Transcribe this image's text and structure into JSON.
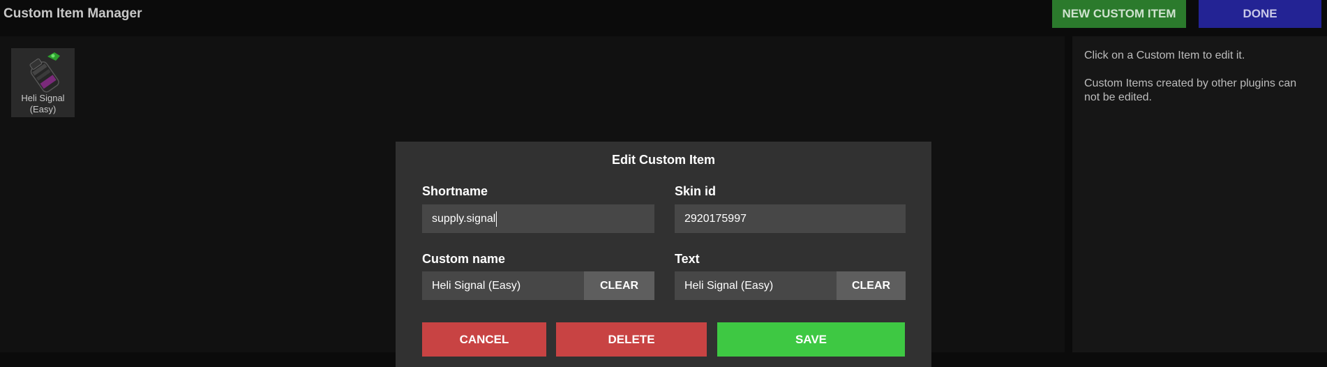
{
  "app": {
    "title": "Custom Item Manager"
  },
  "toolbar": {
    "new_custom_item_label": "NEW CUSTOM ITEM",
    "done_label": "DONE"
  },
  "items": [
    {
      "label_line1": "Heli Signal",
      "label_line2": "(Easy)",
      "icon": "supply-signal-grenade-icon"
    }
  ],
  "sidebar": {
    "hint": "Click on a Custom Item to edit it.",
    "note": "Custom Items created by other plugins can not be edited."
  },
  "dialog": {
    "title": "Edit Custom Item",
    "shortname_label": "Shortname",
    "shortname_value": "supply.signal",
    "skin_id_label": "Skin id",
    "skin_id_value": "2920175997",
    "custom_name_label": "Custom name",
    "custom_name_value": "Heli Signal (Easy)",
    "text_label": "Text",
    "text_value": "Heli Signal (Easy)",
    "clear_label": "CLEAR",
    "cancel_label": "CANCEL",
    "delete_label": "DELETE",
    "save_label": "SAVE"
  },
  "colors": {
    "new_button": "#2b7a2c",
    "done_button": "#232394",
    "danger_button": "#c84343",
    "save_button": "#3ec843"
  }
}
